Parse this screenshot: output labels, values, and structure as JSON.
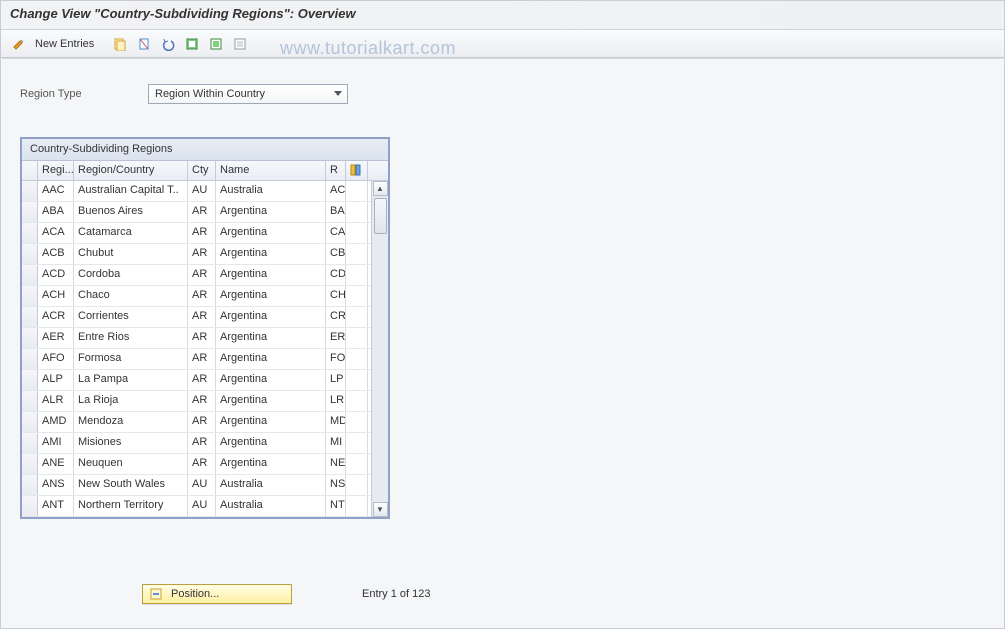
{
  "titlebar": {
    "title": "Change View \"Country-Subdividing Regions\": Overview"
  },
  "toolbar": {
    "new_entries_label": "New Entries"
  },
  "watermark": "www.tutorialkart.com",
  "form": {
    "region_type_label": "Region Type",
    "region_type_value": "Region Within Country"
  },
  "grid": {
    "title": "Country-Subdividing Regions",
    "headers": {
      "regi": "Regi...",
      "region_country": "Region/Country",
      "cty": "Cty",
      "name": "Name",
      "r": "R"
    },
    "rows": [
      {
        "regi": "AAC",
        "rc": "Australian Capital T..",
        "cty": "AU",
        "name": "Australia",
        "r": "AC"
      },
      {
        "regi": "ABA",
        "rc": "Buenos Aires",
        "cty": "AR",
        "name": "Argentina",
        "r": "BA"
      },
      {
        "regi": "ACA",
        "rc": "Catamarca",
        "cty": "AR",
        "name": "Argentina",
        "r": "CA"
      },
      {
        "regi": "ACB",
        "rc": "Chubut",
        "cty": "AR",
        "name": "Argentina",
        "r": "CB"
      },
      {
        "regi": "ACD",
        "rc": "Cordoba",
        "cty": "AR",
        "name": "Argentina",
        "r": "CD"
      },
      {
        "regi": "ACH",
        "rc": "Chaco",
        "cty": "AR",
        "name": "Argentina",
        "r": "CH"
      },
      {
        "regi": "ACR",
        "rc": "Corrientes",
        "cty": "AR",
        "name": "Argentina",
        "r": "CR"
      },
      {
        "regi": "AER",
        "rc": "Entre Rios",
        "cty": "AR",
        "name": "Argentina",
        "r": "ER"
      },
      {
        "regi": "AFO",
        "rc": "Formosa",
        "cty": "AR",
        "name": "Argentina",
        "r": "FO"
      },
      {
        "regi": "ALP",
        "rc": "La Pampa",
        "cty": "AR",
        "name": "Argentina",
        "r": "LP"
      },
      {
        "regi": "ALR",
        "rc": "La Rioja",
        "cty": "AR",
        "name": "Argentina",
        "r": "LR"
      },
      {
        "regi": "AMD",
        "rc": "Mendoza",
        "cty": "AR",
        "name": "Argentina",
        "r": "MD"
      },
      {
        "regi": "AMI",
        "rc": "Misiones",
        "cty": "AR",
        "name": "Argentina",
        "r": "MI"
      },
      {
        "regi": "ANE",
        "rc": "Neuquen",
        "cty": "AR",
        "name": "Argentina",
        "r": "NE"
      },
      {
        "regi": "ANS",
        "rc": "New South Wales",
        "cty": "AU",
        "name": "Australia",
        "r": "NS"
      },
      {
        "regi": "ANT",
        "rc": "Northern Territory",
        "cty": "AU",
        "name": "Australia",
        "r": "NT"
      }
    ]
  },
  "footer": {
    "position_label": "Position...",
    "entry_text": "Entry 1 of 123"
  }
}
